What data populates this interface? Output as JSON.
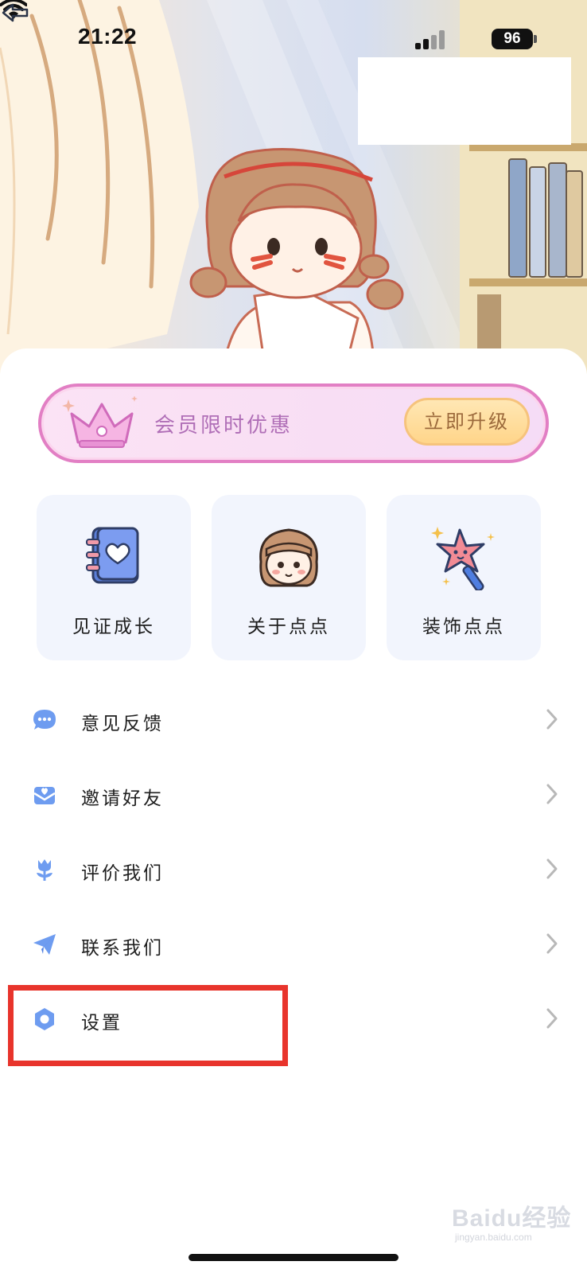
{
  "status_bar": {
    "time": "21:22",
    "battery": "96",
    "signal_icon": "cellular-signal-icon",
    "wifi_icon": "wifi-icon"
  },
  "header": {
    "back_icon": "back-arrow-icon",
    "illustration": "girl-writing-illustration"
  },
  "vip_banner": {
    "icon": "crown-icon",
    "text": "会员限时优惠",
    "button_label": "立即升级",
    "colors": {
      "border": "#e27fc4",
      "text": "#b06fb7",
      "button_text": "#9c6a3c"
    }
  },
  "cards": [
    {
      "label": "见证成长",
      "icon": "notebook-heart-icon"
    },
    {
      "label": "关于点点",
      "icon": "girl-avatar-icon"
    },
    {
      "label": "装饰点点",
      "icon": "star-wand-icon"
    }
  ],
  "menu": [
    {
      "label": "意见反馈",
      "icon": "chat-bubble-icon"
    },
    {
      "label": "邀请好友",
      "icon": "envelope-icon"
    },
    {
      "label": "评价我们",
      "icon": "tulip-icon"
    },
    {
      "label": "联系我们",
      "icon": "paper-plane-icon"
    },
    {
      "label": "设置",
      "icon": "gear-icon"
    }
  ],
  "accent_color": "#6e9cf0",
  "highlight_color": "#e8342c",
  "watermark": {
    "text": "Baidu经验",
    "sub": "jingyan.baidu.com"
  }
}
